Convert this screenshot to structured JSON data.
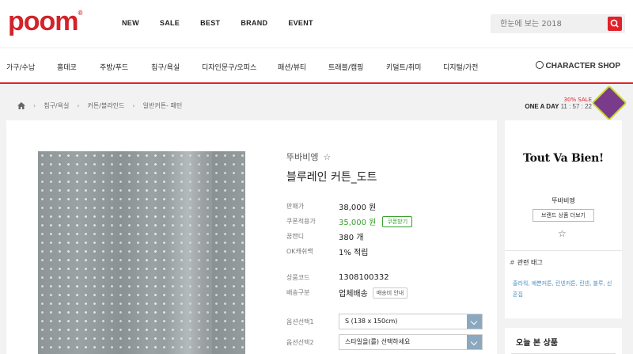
{
  "header": {
    "logo": "poom",
    "logo_mark": "®",
    "nav": [
      "NEW",
      "SALE",
      "BEST",
      "BRAND",
      "EVENT"
    ],
    "search": {
      "placeholder": "한눈에 보는 2018"
    }
  },
  "categories": [
    "가구/수납",
    "홈데코",
    "주방/푸드",
    "침구/욕실",
    "디자인문구/오피스",
    "패션/뷰티",
    "트래블/캠핑",
    "키덜트/취미",
    "디지털/가전"
  ],
  "character_shop": "CHARACTER SHOP",
  "breadcrumb": [
    "침구/욕실",
    "커튼/블라인드",
    "일반커튼- 패턴"
  ],
  "one_a_day": {
    "sale": "30% SALE",
    "label": "ONE A DAY",
    "timer": "11 : 57 : 22"
  },
  "product": {
    "brand": "뚜바비엥",
    "name": "블루레인 커튼_도트",
    "rows": [
      {
        "label": "판매가",
        "value": "38,000 원"
      },
      {
        "label": "쿠폰적용가",
        "value": "35,000 원",
        "button": "쿠폰받기"
      },
      {
        "label": "꿈캔디",
        "value": "380 개"
      },
      {
        "label": "OK캐쉬백",
        "value": "1% 적립"
      }
    ],
    "code_label": "상품코드",
    "code_value": "1308100332",
    "ship_label": "배송구분",
    "ship_value": "업체배송",
    "ship_button": "배송비 안내",
    "options": [
      {
        "label": "옵션선택1",
        "value": "S (138 x 150cm)"
      },
      {
        "label": "옵션선택2",
        "value": "스타일을(를) 선택하세요"
      }
    ]
  },
  "sidebar": {
    "brand_logo_text": "Tout Va Bien!",
    "brand_name": "뚜바비엥",
    "more_button": "브랜드 상품 더보기",
    "tag_title": "관련 태그",
    "tag_hash": "#",
    "tags": "줄라워, 예쁜커튼, 린넨커튼, 린넨, 블루, 신혼집"
  },
  "recent": {
    "title": "오늘 본 상품"
  }
}
